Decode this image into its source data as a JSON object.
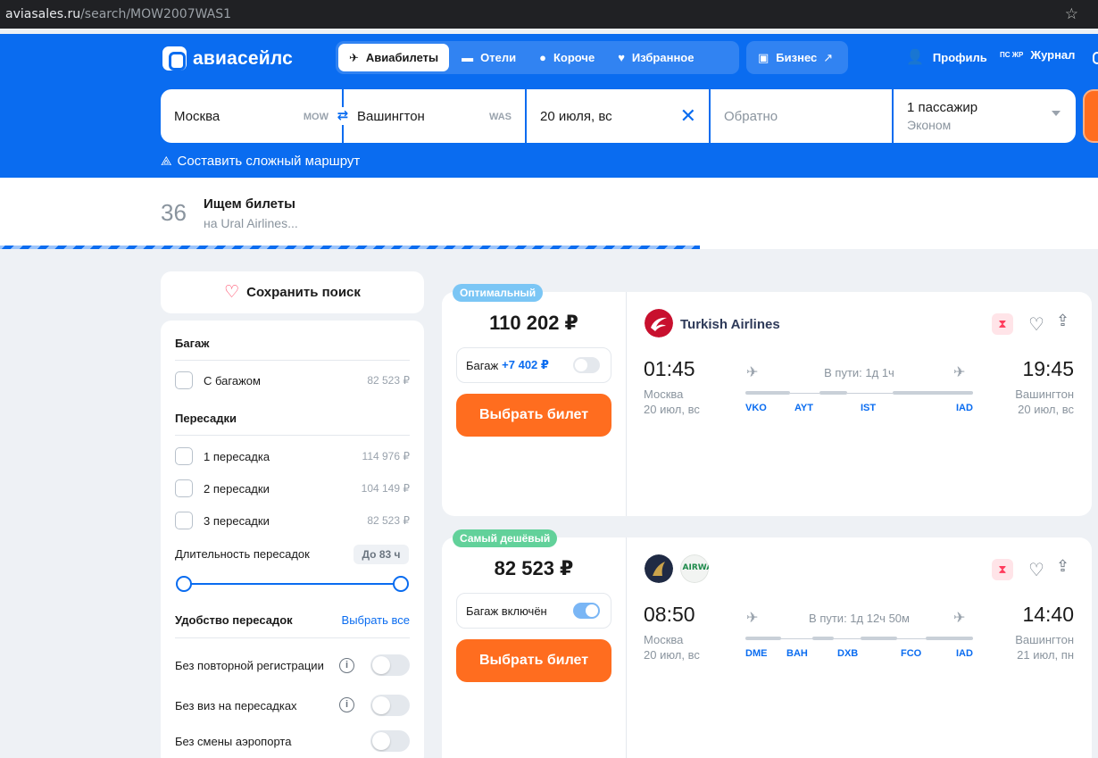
{
  "browser": {
    "url_domain": "aviasales.ru",
    "url_path": "/search/MOW2007WAS1"
  },
  "header": {
    "logo": "авиасейлс",
    "nav": [
      "Авиабилеты",
      "Отели",
      "Короче",
      "Избранное"
    ],
    "business": "Бизнес",
    "profile": "Профиль",
    "journal_icon": "ПС ЖР",
    "journal": "Журнал"
  },
  "search": {
    "from": "Москва",
    "from_code": "MOW",
    "to": "Вашингтон",
    "to_code": "WAS",
    "date": "20 июля, вс",
    "return_placeholder": "Обратно",
    "passengers": "1 пассажир",
    "class": "Эконом",
    "complex_route": "Составить сложный маршрут"
  },
  "progress": {
    "count": "36",
    "title": "Ищем билеты",
    "subtitle": "на Ural Airlines..."
  },
  "sidebar": {
    "save_search": "Сохранить поиск",
    "baggage_title": "Багаж",
    "baggage_option": {
      "label": "С багажом",
      "price": "82 523 ₽"
    },
    "transfers_title": "Пересадки",
    "transfers": [
      {
        "label": "1 пересадка",
        "price": "114 976 ₽"
      },
      {
        "label": "2 пересадки",
        "price": "104 149 ₽"
      },
      {
        "label": "3 пересадки",
        "price": "82 523 ₽"
      }
    ],
    "duration_label": "Длительность пересадок",
    "duration_value": "До 83 ч",
    "comfort_title": "Удобство пересадок",
    "select_all": "Выбрать все",
    "comfort": [
      "Без повторной регистрации",
      "Без виз на пересадках",
      "Без смены аэропорта"
    ]
  },
  "tickets": [
    {
      "badge": "Оптимальный",
      "price": "110 202 ₽",
      "baggage": "Багаж",
      "baggage_extra": "+7 402 ₽",
      "buy": "Выбрать билет",
      "airline": "Turkish Airlines",
      "dep_time": "01:45",
      "dep_city": "Москва",
      "dep_date": "20 июл, вс",
      "arr_time": "19:45",
      "arr_city": "Вашингтон",
      "arr_date": "20 июл, вс",
      "duration": "В пути: 1д 1ч",
      "stops": [
        "VKO",
        "AYT",
        "IST",
        "IAD"
      ]
    },
    {
      "badge": "Самый дешёвый",
      "price": "82 523 ₽",
      "baggage": "Багаж включён",
      "buy": "Выбрать билет",
      "airline_logo_text": "ITA AIRWAYS",
      "dep_time": "08:50",
      "dep_city": "Москва",
      "dep_date": "20 июл, вс",
      "arr_time": "14:40",
      "arr_city": "Вашингтон",
      "arr_date": "21 июл, пн",
      "duration": "В пути: 1д 12ч 50м",
      "stops": [
        "DME",
        "BAH",
        "DXB",
        "FCO",
        "IAD"
      ]
    }
  ],
  "colors": {
    "brand_blue": "#0a6cf0",
    "orange": "#ff6d1f",
    "badge_optimal": "#7bc6f5",
    "badge_cheap": "#62d19a"
  }
}
